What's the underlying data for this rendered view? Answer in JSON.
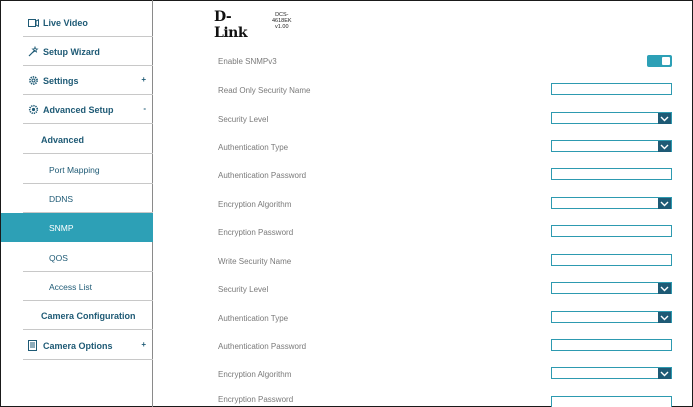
{
  "header": {
    "logo": "D-Link",
    "model": "DCS-4618EK",
    "version": "v1.00"
  },
  "sidebar": {
    "items": [
      {
        "label": "Live Video",
        "icon": "video-icon"
      },
      {
        "label": "Setup Wizard",
        "icon": "wand-icon"
      },
      {
        "label": "Settings",
        "icon": "gear-icon",
        "expander": "+"
      },
      {
        "label": "Advanced Setup",
        "icon": "advanced-gear-icon",
        "expander": "-"
      },
      {
        "label": "Advanced"
      },
      {
        "label": "Port Mapping"
      },
      {
        "label": "DDNS"
      },
      {
        "label": "SNMP",
        "active": true
      },
      {
        "label": "QOS"
      },
      {
        "label": "Access List"
      },
      {
        "label": "Camera Configuration"
      },
      {
        "label": "Camera Options",
        "icon": "document-icon",
        "expander": "+"
      }
    ]
  },
  "form": {
    "enable_snmpv3": {
      "label": "Enable SNMPv3",
      "on": true
    },
    "fields": [
      {
        "label": "Read Only Security Name",
        "type": "text",
        "value": ""
      },
      {
        "label": "Security Level",
        "type": "select",
        "value": ""
      },
      {
        "label": "Authentication Type",
        "type": "select",
        "value": ""
      },
      {
        "label": "Authentication Password",
        "type": "text",
        "value": ""
      },
      {
        "label": "Encryption Algorithm",
        "type": "select",
        "value": ""
      },
      {
        "label": "Encryption Password",
        "type": "text",
        "value": ""
      },
      {
        "label": "Write Security Name",
        "type": "text",
        "value": ""
      },
      {
        "label": "Security Level",
        "type": "select",
        "value": ""
      },
      {
        "label": "Authentication Type",
        "type": "select",
        "value": ""
      },
      {
        "label": "Authentication Password",
        "type": "text",
        "value": ""
      },
      {
        "label": "Encryption Algorithm",
        "type": "select",
        "value": ""
      },
      {
        "label": "Encryption Password",
        "type": "text",
        "value": ""
      }
    ]
  },
  "colors": {
    "accent": "#2da0b6",
    "nav_text": "#1e5a75",
    "label_gray": "#7a7a7a"
  }
}
